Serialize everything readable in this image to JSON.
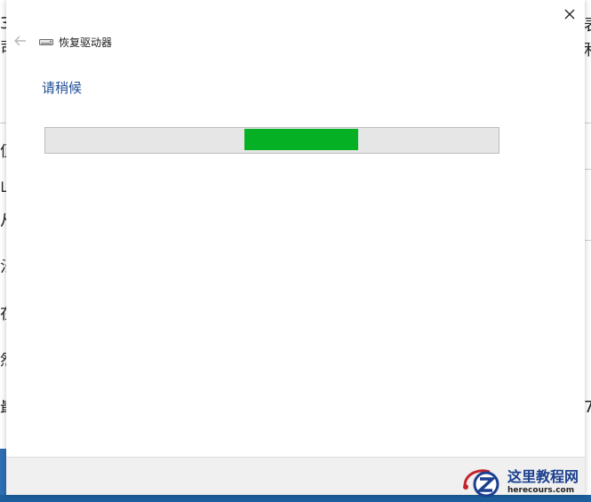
{
  "dialog": {
    "title": "恢复驱动器",
    "heading": "请稍候",
    "progress": {
      "chunk_start_fraction": 0.44,
      "chunk_width_fraction": 0.25
    }
  },
  "background": {
    "left_fragments": [
      "3",
      "司",
      "值",
      "山",
      "从",
      "法",
      "在",
      "然",
      "最"
    ],
    "right_fragments": [
      "表",
      "利",
      "7"
    ]
  },
  "watermark": {
    "main": "这里教程网",
    "sub": "herecours.com"
  },
  "colors": {
    "progress_fill": "#06b025",
    "progress_track": "#e6e6e6",
    "heading": "#1e4e96",
    "footer": "#f0f0f0"
  },
  "icons": {
    "close": "close-icon",
    "back": "back-arrow-icon",
    "drive": "drive-icon"
  }
}
